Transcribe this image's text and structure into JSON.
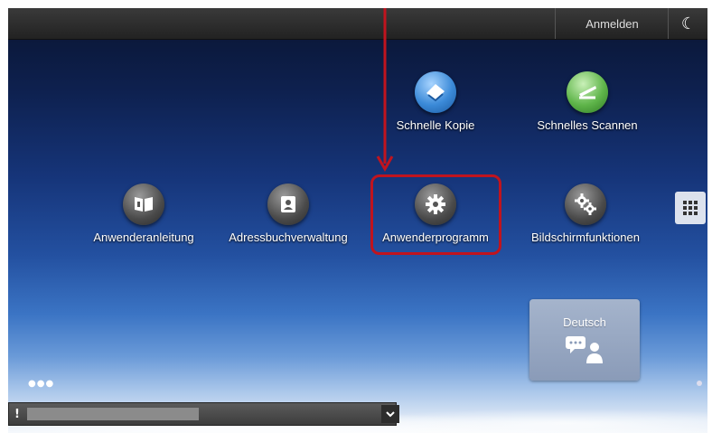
{
  "topbar": {
    "login_label": "Anmelden",
    "mode_icon": "moon-icon"
  },
  "apps_row1": [
    {
      "label": "Schnelle Kopie",
      "icon": "copy-icon"
    },
    {
      "label": "Schnelles Scannen",
      "icon": "scan-icon"
    }
  ],
  "apps_row2": [
    {
      "label": "Anwenderanleitung",
      "icon": "book-icon"
    },
    {
      "label": "Adressbuchverwaltung",
      "icon": "address-book-icon"
    },
    {
      "label": "Anwenderprogramm",
      "icon": "gear-icon"
    },
    {
      "label": "Bildschirmfunktionen",
      "icon": "gears-icon"
    }
  ],
  "language": {
    "label": "Deutsch",
    "icon": "language-person-icon"
  },
  "annotation": {
    "color": "#c0141e",
    "target": "Anwenderprogramm"
  },
  "statusbar": {
    "alert_icon": "exclamation-icon",
    "expand_icon": "chevron-down-icon"
  }
}
